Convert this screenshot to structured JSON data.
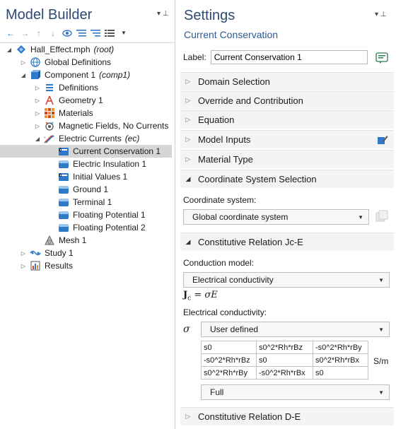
{
  "left_panel": {
    "title": "Model Builder",
    "pins": "▾ ⊥",
    "toolbar_icons": [
      "back-arrow-icon",
      "forward-arrow-icon",
      "up-arrow-icon",
      "down-arrow-icon",
      "show-icon",
      "collapse-all-icon",
      "expand-all-icon",
      "list-icon",
      "dropdown-icon"
    ],
    "tree": [
      {
        "label": "Hall_Effect.mph",
        "tag": "(root)",
        "level": 0,
        "expanded": true,
        "icon": "file-icon"
      },
      {
        "label": "Global Definitions",
        "tag": "",
        "level": 1,
        "expanded": false,
        "icon": "globe-icon"
      },
      {
        "label": "Component 1",
        "tag": "(comp1)",
        "level": 1,
        "expanded": true,
        "icon": "component-icon"
      },
      {
        "label": "Definitions",
        "tag": "",
        "level": 2,
        "expanded": false,
        "icon": "definitions-icon"
      },
      {
        "label": "Geometry 1",
        "tag": "",
        "level": 2,
        "expanded": false,
        "icon": "geometry-icon"
      },
      {
        "label": "Materials",
        "tag": "",
        "level": 2,
        "expanded": false,
        "icon": "materials-icon"
      },
      {
        "label": "Magnetic Fields, No Currents",
        "tag": "",
        "level": 2,
        "expanded": false,
        "icon": "magnetic-fields-icon"
      },
      {
        "label": "Electric Currents",
        "tag": "(ec)",
        "level": 2,
        "expanded": true,
        "icon": "electric-currents-icon"
      },
      {
        "label": "Current Conservation 1",
        "tag": "",
        "level": 3,
        "selected": true,
        "icon": "domain-feature-icon"
      },
      {
        "label": "Electric Insulation 1",
        "tag": "",
        "level": 3,
        "icon": "boundary-feature-icon"
      },
      {
        "label": "Initial Values 1",
        "tag": "",
        "level": 3,
        "icon": "domain-feature-icon"
      },
      {
        "label": "Ground 1",
        "tag": "",
        "level": 3,
        "icon": "boundary-feature-icon"
      },
      {
        "label": "Terminal 1",
        "tag": "",
        "level": 3,
        "icon": "boundary-feature-icon"
      },
      {
        "label": "Floating Potential 1",
        "tag": "",
        "level": 3,
        "icon": "boundary-feature-icon"
      },
      {
        "label": "Floating Potential 2",
        "tag": "",
        "level": 3,
        "icon": "boundary-feature-icon"
      },
      {
        "label": "Mesh 1",
        "tag": "",
        "level": 2,
        "icon": "mesh-icon"
      },
      {
        "label": "Study 1",
        "tag": "",
        "level": 1,
        "expanded": false,
        "icon": "study-icon"
      },
      {
        "label": "Results",
        "tag": "",
        "level": 1,
        "expanded": false,
        "icon": "results-icon"
      }
    ]
  },
  "settings": {
    "title": "Settings",
    "pins": "▾ ⊥",
    "subtitle": "Current Conservation",
    "label_caption": "Label:",
    "label_value": "Current Conservation 1",
    "sections": {
      "domain_selection": "Domain Selection",
      "override": "Override and Contribution",
      "equation": "Equation",
      "model_inputs": "Model Inputs",
      "material_type": "Material Type",
      "coord_system": "Coordinate System Selection",
      "constitutive_jc": "Constitutive Relation Jc-E",
      "constitutive_de": "Constitutive Relation D-E"
    },
    "coordinate_system_label": "Coordinate system:",
    "coordinate_system_value": "Global coordinate system",
    "conduction_model_label": "Conduction model:",
    "conduction_model_value": "Electrical conductivity",
    "equation_lhs": "J",
    "equation_sub": "c",
    "equation_rhs": " = σE",
    "electrical_conductivity_label": "Electrical conductivity:",
    "sigma_symbol": "σ",
    "conductivity_source": "User defined",
    "matrix": [
      [
        "s0",
        "s0^2*Rh*rBz",
        "-s0^2*Rh*rBy"
      ],
      [
        "-s0^2*Rh*rBz",
        "s0",
        "s0^2*Rh*rBx"
      ],
      [
        "s0^2*Rh*rBy",
        "-s0^2*Rh*rBx",
        "s0"
      ]
    ],
    "unit": "S/m",
    "matrix_type": "Full"
  },
  "colors": {
    "title": "#2e4a73",
    "accent_blue": "#2f79c9",
    "selected_row": "#d6d6d6",
    "section_bg": "#f4f4f4"
  }
}
